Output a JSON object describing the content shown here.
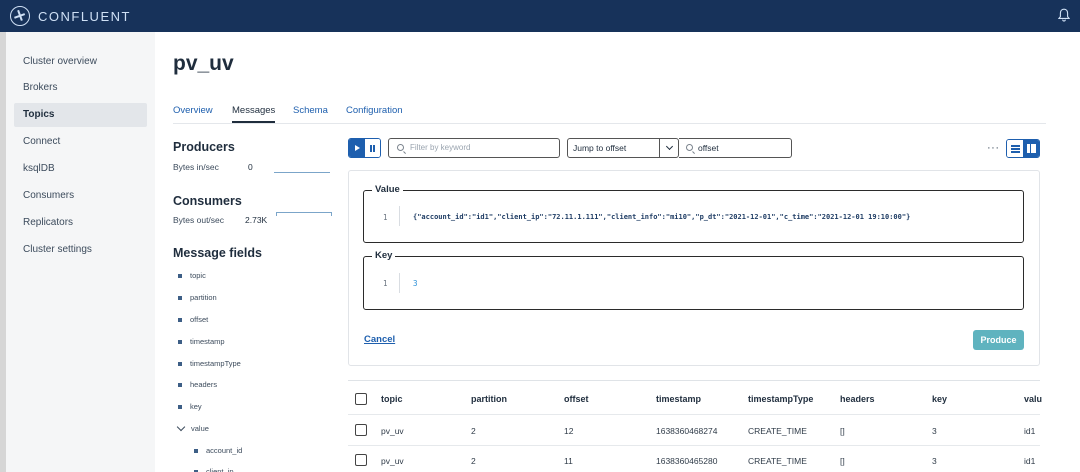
{
  "brand": {
    "name": "CONFLUENT",
    "logo_icon": "confluent-logo-icon",
    "notification_icon": "bell-icon"
  },
  "sidebar": {
    "items": [
      {
        "label": "Cluster overview",
        "active": false
      },
      {
        "label": "Brokers",
        "active": false
      },
      {
        "label": "Topics",
        "active": true
      },
      {
        "label": "Connect",
        "active": false
      },
      {
        "label": "ksqlDB",
        "active": false
      },
      {
        "label": "Consumers",
        "active": false
      },
      {
        "label": "Replicators",
        "active": false
      },
      {
        "label": "Cluster settings",
        "active": false
      }
    ]
  },
  "page": {
    "title": "pv_uv"
  },
  "tabs": [
    {
      "label": "Overview",
      "active": false
    },
    {
      "label": "Messages",
      "active": true
    },
    {
      "label": "Schema",
      "active": false
    },
    {
      "label": "Configuration",
      "active": false
    }
  ],
  "producers": {
    "heading": "Producers",
    "label": "Bytes in/sec",
    "value": "0"
  },
  "consumers": {
    "heading": "Consumers",
    "label": "Bytes out/sec",
    "value": "2.73K"
  },
  "message_fields": {
    "heading": "Message fields",
    "items": [
      "topic",
      "partition",
      "offset",
      "timestamp",
      "timestampType",
      "headers",
      "key"
    ],
    "expanded": "value",
    "sub_items": [
      "account_id",
      "client_ip"
    ]
  },
  "toolbar": {
    "filter_placeholder": "Filter by keyword",
    "jump_label": "Jump to offset",
    "offset_placeholder": "offset",
    "more_label": "···"
  },
  "produce": {
    "value_legend": "Value",
    "value_line": "1",
    "value_text": "{\"account_id\":\"id1\",\"client_ip\":\"72.11.1.111\",\"client_info\":\"mi10\",\"p_dt\":\"2021-12-01\",\"c_time\":\"2021-12-01 19:10:00\"}",
    "key_legend": "Key",
    "key_line": "1",
    "key_text": "3",
    "cancel_label": "Cancel",
    "produce_label": "Produce"
  },
  "table": {
    "columns": [
      "topic",
      "partition",
      "offset",
      "timestamp",
      "timestampType",
      "headers",
      "key",
      "valu"
    ],
    "rows": [
      [
        "pv_uv",
        "2",
        "12",
        "1638360468274",
        "CREATE_TIME",
        "[]",
        "3",
        "id1"
      ],
      [
        "pv_uv",
        "2",
        "11",
        "1638360465280",
        "CREATE_TIME",
        "[]",
        "3",
        "id1"
      ]
    ]
  },
  "colors": {
    "topbar": "#17325a",
    "accent": "#1e5fae",
    "produce_button": "#5fb3bf"
  }
}
